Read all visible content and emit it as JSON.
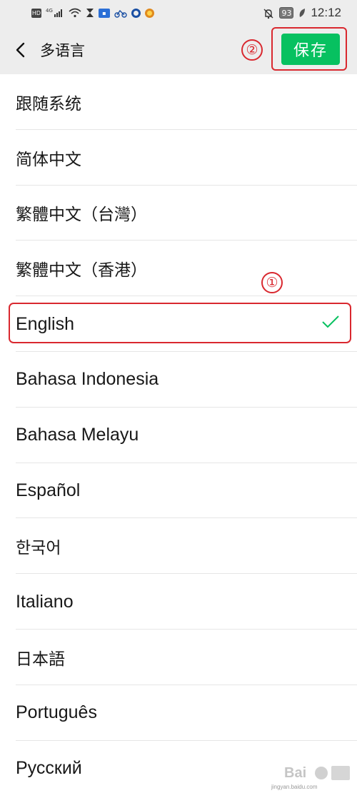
{
  "status_bar": {
    "network": "HD",
    "signal_label": "4G",
    "battery": "93",
    "time": "12:12"
  },
  "nav": {
    "title": "多语言",
    "save_label": "保存",
    "annotation_save": "②"
  },
  "annotation_selected": "①",
  "languages": [
    {
      "label": "跟随系统",
      "selected": false
    },
    {
      "label": "简体中文",
      "selected": false
    },
    {
      "label": "繁體中文（台灣）",
      "selected": false
    },
    {
      "label": "繁體中文（香港）",
      "selected": false
    },
    {
      "label": "English",
      "selected": true
    },
    {
      "label": "Bahasa Indonesia",
      "selected": false
    },
    {
      "label": "Bahasa Melayu",
      "selected": false
    },
    {
      "label": "Español",
      "selected": false
    },
    {
      "label": "한국어",
      "selected": false
    },
    {
      "label": "Italiano",
      "selected": false
    },
    {
      "label": "日本語",
      "selected": false
    },
    {
      "label": "Português",
      "selected": false
    },
    {
      "label": "Русский",
      "selected": false
    }
  ],
  "colors": {
    "accent_green": "#07c160",
    "annotation_red": "#d9282f",
    "nav_background": "#ededed"
  },
  "watermark": {
    "brand": "Bai",
    "caption": "jingyan.baidu.com"
  }
}
